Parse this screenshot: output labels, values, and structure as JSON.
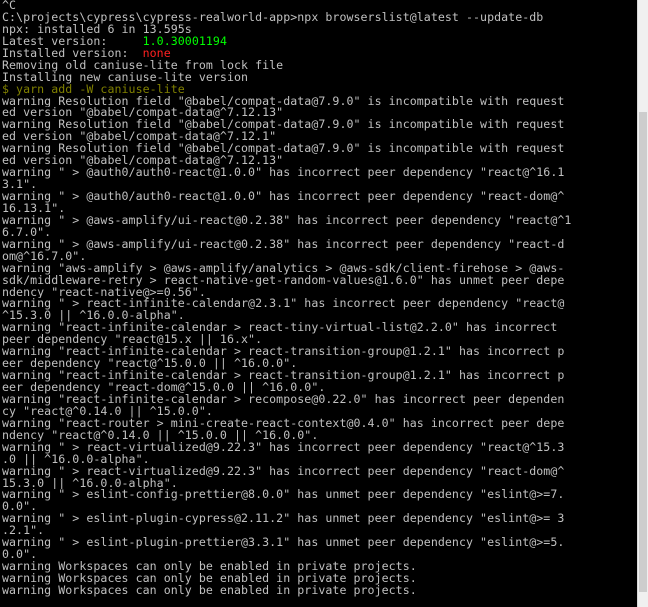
{
  "console": {
    "lines": [
      {
        "text": "^C"
      },
      {
        "text": "C:\\projects\\cypress\\cypress-realworld-app>npx browserslist@latest --update-db"
      },
      {
        "text": "npx: installed 6 in 13.595s"
      },
      {
        "label": "Latest version:     ",
        "value": "1.0.30001194",
        "style": "green"
      },
      {
        "label": "Installed version:  ",
        "value": "none",
        "style": "red"
      },
      {
        "text": "Removing old caniuse-lite from lock file"
      },
      {
        "text": "Installing new caniuse-lite version"
      },
      {
        "text": "$ yarn add -W caniuse-lite",
        "style": "yellow"
      },
      {
        "text": "warning Resolution field \"@babel/compat-data@7.9.0\" is incompatible with request"
      },
      {
        "text": "ed version \"@babel/compat-data@^7.12.13\""
      },
      {
        "text": "warning Resolution field \"@babel/compat-data@7.9.0\" is incompatible with request"
      },
      {
        "text": "ed version \"@babel/compat-data@^7.12.1\""
      },
      {
        "text": "warning Resolution field \"@babel/compat-data@7.9.0\" is incompatible with request"
      },
      {
        "text": "ed version \"@babel/compat-data@^7.12.13\""
      },
      {
        "text": "warning \" > @auth0/auth0-react@1.0.0\" has incorrect peer dependency \"react@^16.1"
      },
      {
        "text": "3.1\"."
      },
      {
        "text": "warning \" > @auth0/auth0-react@1.0.0\" has incorrect peer dependency \"react-dom@^"
      },
      {
        "text": "16.13.1\"."
      },
      {
        "text": "warning \" > @aws-amplify/ui-react@0.2.38\" has incorrect peer dependency \"react@^1"
      },
      {
        "text": "6.7.0\"."
      },
      {
        "text": "warning \" > @aws-amplify/ui-react@0.2.38\" has incorrect peer dependency \"react-d"
      },
      {
        "text": "om@^16.7.0\"."
      },
      {
        "text": "warning \"aws-amplify > @aws-amplify/analytics > @aws-sdk/client-firehose > @aws-"
      },
      {
        "text": "sdk/middleware-retry > react-native-get-random-values@1.6.0\" has unmet peer depe"
      },
      {
        "text": "ndency \"react-native@>=0.56\"."
      },
      {
        "text": "warning \" > react-infinite-calendar@2.3.1\" has incorrect peer dependency \"react@"
      },
      {
        "text": "^15.3.0 || ^16.0.0-alpha\"."
      },
      {
        "text": "warning \"react-infinite-calendar > react-tiny-virtual-list@2.2.0\" has incorrect"
      },
      {
        "text": "peer dependency \"react@15.x || 16.x\"."
      },
      {
        "text": "warning \"react-infinite-calendar > react-transition-group@1.2.1\" has incorrect p"
      },
      {
        "text": "eer dependency \"react@^15.0.0 || ^16.0.0\"."
      },
      {
        "text": "warning \"react-infinite-calendar > react-transition-group@1.2.1\" has incorrect p"
      },
      {
        "text": "eer dependency \"react-dom@^15.0.0 || ^16.0.0\"."
      },
      {
        "text": "warning \"react-infinite-calendar > recompose@0.22.0\" has incorrect peer dependen"
      },
      {
        "text": "cy \"react@^0.14.0 || ^15.0.0\"."
      },
      {
        "text": "warning \"react-router > mini-create-react-context@0.4.0\" has incorrect peer depe"
      },
      {
        "text": "ndency \"react@^0.14.0 || ^15.0.0 || ^16.0.0\"."
      },
      {
        "text": "warning \" > react-virtualized@9.22.3\" has incorrect peer dependency \"react@^15.3"
      },
      {
        "text": ".0 || ^16.0.0-alpha\"."
      },
      {
        "text": "warning \" > react-virtualized@9.22.3\" has incorrect peer dependency \"react-dom@^"
      },
      {
        "text": "15.3.0 || ^16.0.0-alpha\"."
      },
      {
        "text": "warning \" > eslint-config-prettier@8.0.0\" has unmet peer dependency \"eslint@>=7."
      },
      {
        "text": "0.0\"."
      },
      {
        "text": "warning \" > eslint-plugin-cypress@2.11.2\" has unmet peer dependency \"eslint@>= 3"
      },
      {
        "text": ".2.1\"."
      },
      {
        "text": "warning \" > eslint-plugin-prettier@3.3.1\" has unmet peer dependency \"eslint@>=5."
      },
      {
        "text": "0.0\"."
      },
      {
        "text": "warning Workspaces can only be enabled in private projects."
      },
      {
        "text": "warning Workspaces can only be enabled in private projects."
      },
      {
        "text": "warning Workspaces can only be enabled in private projects."
      }
    ]
  },
  "colors": {
    "background": "#000000",
    "text": "#c0c0c0",
    "green": "#00ff00",
    "red": "#ff2020",
    "yellow": "#808000"
  }
}
